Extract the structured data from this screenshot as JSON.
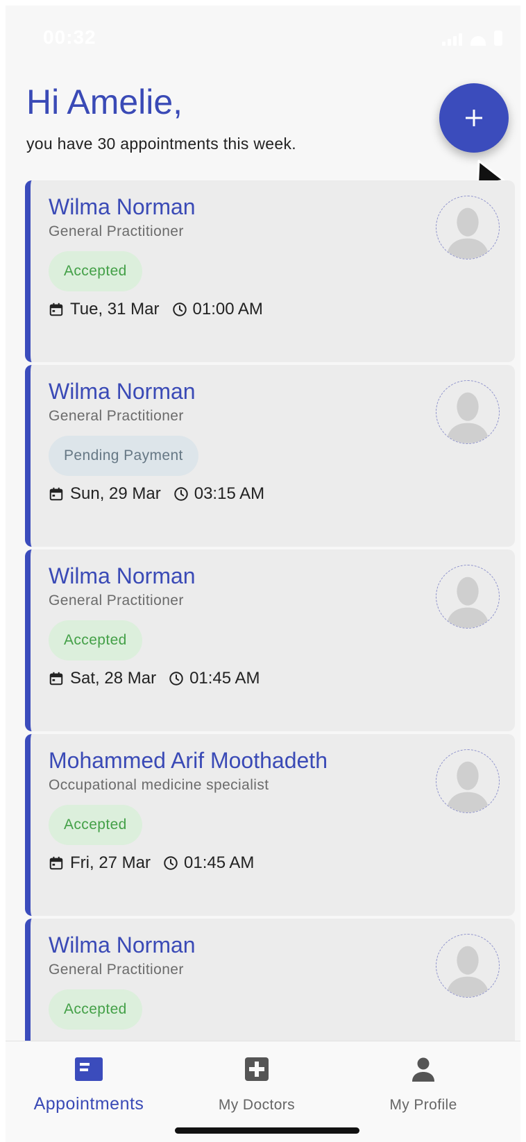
{
  "status_bar": {
    "time": "00:32"
  },
  "header": {
    "greeting": "Hi Amelie,",
    "subtitle": "you have 30 appointments this week.",
    "add_button": "add-appointment"
  },
  "appointments": [
    {
      "doctor": "Wilma Norman",
      "specialty": "General Practitioner",
      "status": "Accepted",
      "date": "Tue, 31 Mar",
      "time": "01:00 AM"
    },
    {
      "doctor": "Wilma Norman",
      "specialty": "General Practitioner",
      "status": "Pending Payment",
      "date": "Sun, 29 Mar",
      "time": "03:15 AM"
    },
    {
      "doctor": "Wilma Norman",
      "specialty": "General Practitioner",
      "status": "Accepted",
      "date": "Sat, 28 Mar",
      "time": "01:45 AM"
    },
    {
      "doctor": "Mohammed Arif Moothadeth",
      "specialty": "Occupational medicine specialist",
      "status": "Accepted",
      "date": "Fri, 27 Mar",
      "time": "01:45 AM"
    },
    {
      "doctor": "Wilma Norman",
      "specialty": "General Practitioner",
      "status": "Accepted",
      "date": "",
      "time": ""
    }
  ],
  "bottom_nav": {
    "items": [
      {
        "label": "Appointments",
        "icon": "appointments-icon",
        "active": true
      },
      {
        "label": "My Doctors",
        "icon": "medical-cross-icon",
        "active": false
      },
      {
        "label": "My Profile",
        "icon": "person-icon",
        "active": false
      }
    ]
  },
  "colors": {
    "primary": "#3b4cbc",
    "accepted_text": "#43a047",
    "accepted_bg": "#dcefdc",
    "pending_text": "#667885",
    "pending_bg": "#dde5ea",
    "card_bg": "#ececec"
  }
}
